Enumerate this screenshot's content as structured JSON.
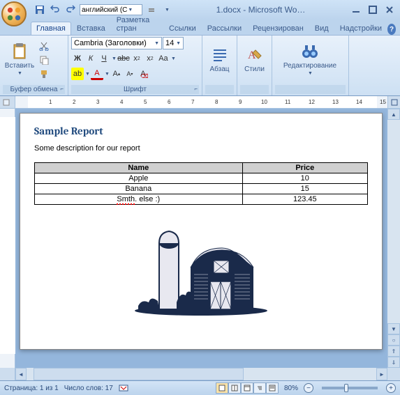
{
  "window": {
    "title": "1.docx - Microsoft Wo…",
    "language": "английский (С"
  },
  "tabs": [
    "Главная",
    "Вставка",
    "Разметка стран",
    "Ссылки",
    "Рассылки",
    "Рецензирован",
    "Вид",
    "Надстройки"
  ],
  "ribbon": {
    "clipboard": {
      "label": "Буфер обмена",
      "paste": "Вставить"
    },
    "font": {
      "label": "Шрифт",
      "name": "Cambria (Заголовки)",
      "size": "14"
    },
    "paragraph": {
      "label": "Абзац"
    },
    "styles": {
      "label": "Стили"
    },
    "editing": {
      "label": "Редактирование"
    }
  },
  "document": {
    "title": "Sample Report",
    "description": "Some description for our report",
    "table": {
      "headers": [
        "Name",
        "Price"
      ],
      "rows": [
        {
          "name": "Apple",
          "price": "10",
          "squiggle": false
        },
        {
          "name": "Banana",
          "price": "15",
          "squiggle": false
        },
        {
          "name": "Smth. else :)",
          "price": "123.45",
          "squiggle": true,
          "squiggle_text": "Smth"
        }
      ]
    }
  },
  "status": {
    "page": "Страница: 1 из 1",
    "words": "Число слов: 17",
    "zoom": "80%"
  }
}
